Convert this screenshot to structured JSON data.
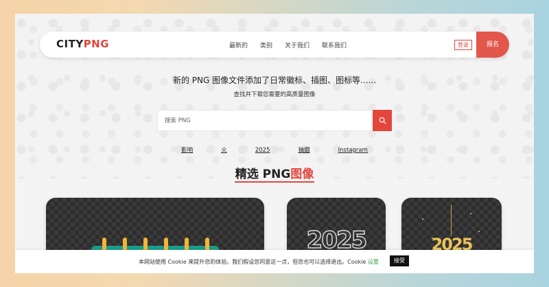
{
  "header": {
    "logo_part1": "CITY",
    "logo_part2": "PNG",
    "nav": [
      "最新的",
      "类别",
      "关于我们",
      "联系我们"
    ],
    "login_label": "登录",
    "signup_label": "报名"
  },
  "hero": {
    "headline": "新的 PNG 图像文件添加了日常徽标、插图、图标等......",
    "subheadline": "查找并下载您需要的高质量图像"
  },
  "search": {
    "placeholder": "搜索 PNG",
    "icon": "search-icon"
  },
  "tags": [
    "影响",
    "火",
    "2025",
    "抽烟",
    "Instagram"
  ],
  "featured": {
    "title_part1": "精选 PNG",
    "title_part2": "图像",
    "cards": [
      {
        "icon": "calendar-icon"
      },
      {
        "text": "2025"
      },
      {
        "text": "2025"
      }
    ]
  },
  "cookie": {
    "text": "本网站使用 Cookie 来提升您的体验。我们假设您同意这一点，但您也可以选择退出。Cookie",
    "settings_label": "设置",
    "accept_label": "接受"
  },
  "colors": {
    "accent": "#e2463d",
    "calendar": "#1a9e8a",
    "gold": "#e9c25a"
  }
}
